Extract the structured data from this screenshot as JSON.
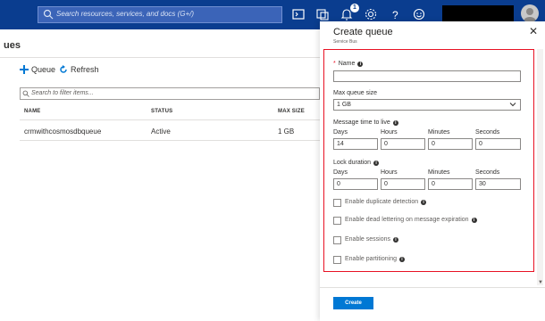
{
  "topbar": {
    "search_placeholder": "Search resources, services, and docs (G+/)",
    "notification_count": "1",
    "icons": [
      "cloud-shell-icon",
      "directory-filter-icon",
      "notifications-icon",
      "settings-icon",
      "help-icon",
      "feedback-icon"
    ]
  },
  "left": {
    "title": "ues",
    "toolbar": {
      "add_queue": "Queue",
      "refresh": "Refresh"
    },
    "filter_placeholder": "Search to filter items...",
    "columns": [
      "NAME",
      "STATUS",
      "MAX SIZE"
    ],
    "rows": [
      {
        "name": "crmwithcosmosdbqueue",
        "status": "Active",
        "max_size": "1 GB"
      }
    ]
  },
  "panel": {
    "title": "Create queue",
    "subtitle": "Service Bus",
    "name_label": "Name",
    "name_value": "",
    "max_size_label": "Max queue size",
    "max_size_value": "1 GB",
    "ttl_label": "Message time to live",
    "lock_label": "Lock duration",
    "units": {
      "days": "Days",
      "hours": "Hours",
      "minutes": "Minutes",
      "seconds": "Seconds"
    },
    "ttl": {
      "days": "14",
      "hours": "0",
      "minutes": "0",
      "seconds": "0"
    },
    "lock": {
      "days": "0",
      "hours": "0",
      "minutes": "0",
      "seconds": "30"
    },
    "checkboxes": {
      "duplicate": "Enable duplicate detection",
      "dead_letter": "Enable dead lettering on message expiration",
      "sessions": "Enable sessions",
      "partitioning": "Enable partitioning"
    },
    "create_label": "Create"
  },
  "colors": {
    "topbar": "#0a3d8f",
    "accent": "#0078d4",
    "highlight_border": "#e81123"
  }
}
